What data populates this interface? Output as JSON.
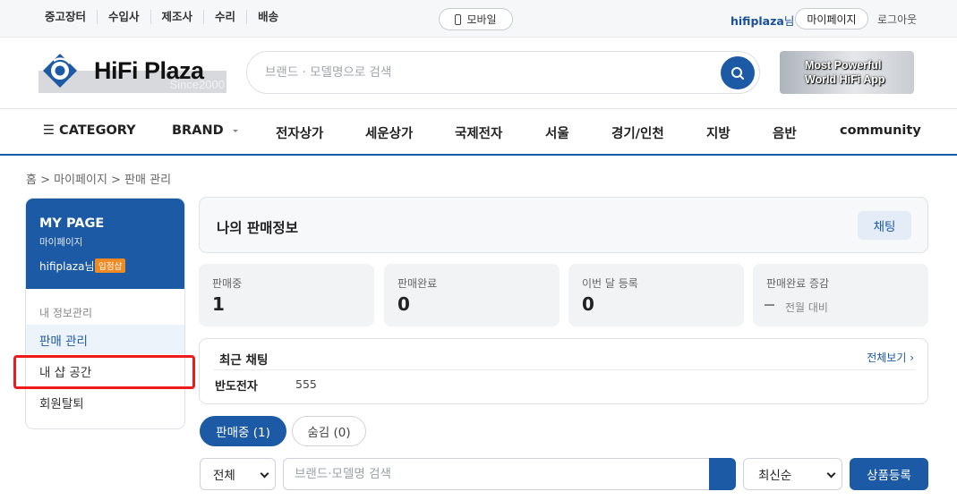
{
  "topbar": {
    "links": [
      "중고장터",
      "수입사",
      "제조사",
      "수리",
      "배송"
    ],
    "mobile_label": "모바일",
    "username": "hifiplaza",
    "username_suffix": "님",
    "mypage_label": "마이페이지",
    "logout_label": "로그아웃"
  },
  "header": {
    "logo_text": "HiFi Plaza",
    "logo_since": "Since2000",
    "search_placeholder": "브랜드 · 모델명으로 검색",
    "banner_line1": "Most Powerful",
    "banner_line2": "World HiFi App"
  },
  "catnav": {
    "category_label": "☰ CATEGORY",
    "brand_label": "BRAND",
    "items": [
      "전자상가",
      "세운상가",
      "국제전자",
      "서울",
      "경기/인천",
      "지방",
      "음반",
      "community"
    ]
  },
  "breadcrumb": "홈 > 마이페이지 > 판매 관리",
  "sidebar": {
    "title": "MY PAGE",
    "subtitle": "마이페이지",
    "user": "hifiplaza님",
    "badge": "입점샵",
    "section_label": "내 정보관리",
    "items": [
      "판매 관리",
      "내 샵 공간",
      "회원탈퇴"
    ]
  },
  "panel": {
    "title": "나의 판매정보",
    "chat_label": "채팅"
  },
  "stats": [
    {
      "label": "판매중",
      "value": "1"
    },
    {
      "label": "판매완료",
      "value": "0"
    },
    {
      "label": "이번 달 등록",
      "value": "0"
    },
    {
      "label": "판매완료 증감",
      "note": "전월 대비"
    }
  ],
  "recent_chat": {
    "title": "최근 채팅",
    "view_all": "전체보기 ›",
    "name": "반도전자",
    "message": "555"
  },
  "tabs": {
    "active": "판매중 (1)",
    "inactive": "숨김 (0)"
  },
  "filters": {
    "scope": "전체",
    "search_placeholder": "브랜드·모델명 검색",
    "sort": "최신순",
    "register_label": "상품등록"
  },
  "colors": {
    "brand": "#1c5aa6",
    "badge": "#f08a24",
    "highlight": "#ef1a1a"
  }
}
